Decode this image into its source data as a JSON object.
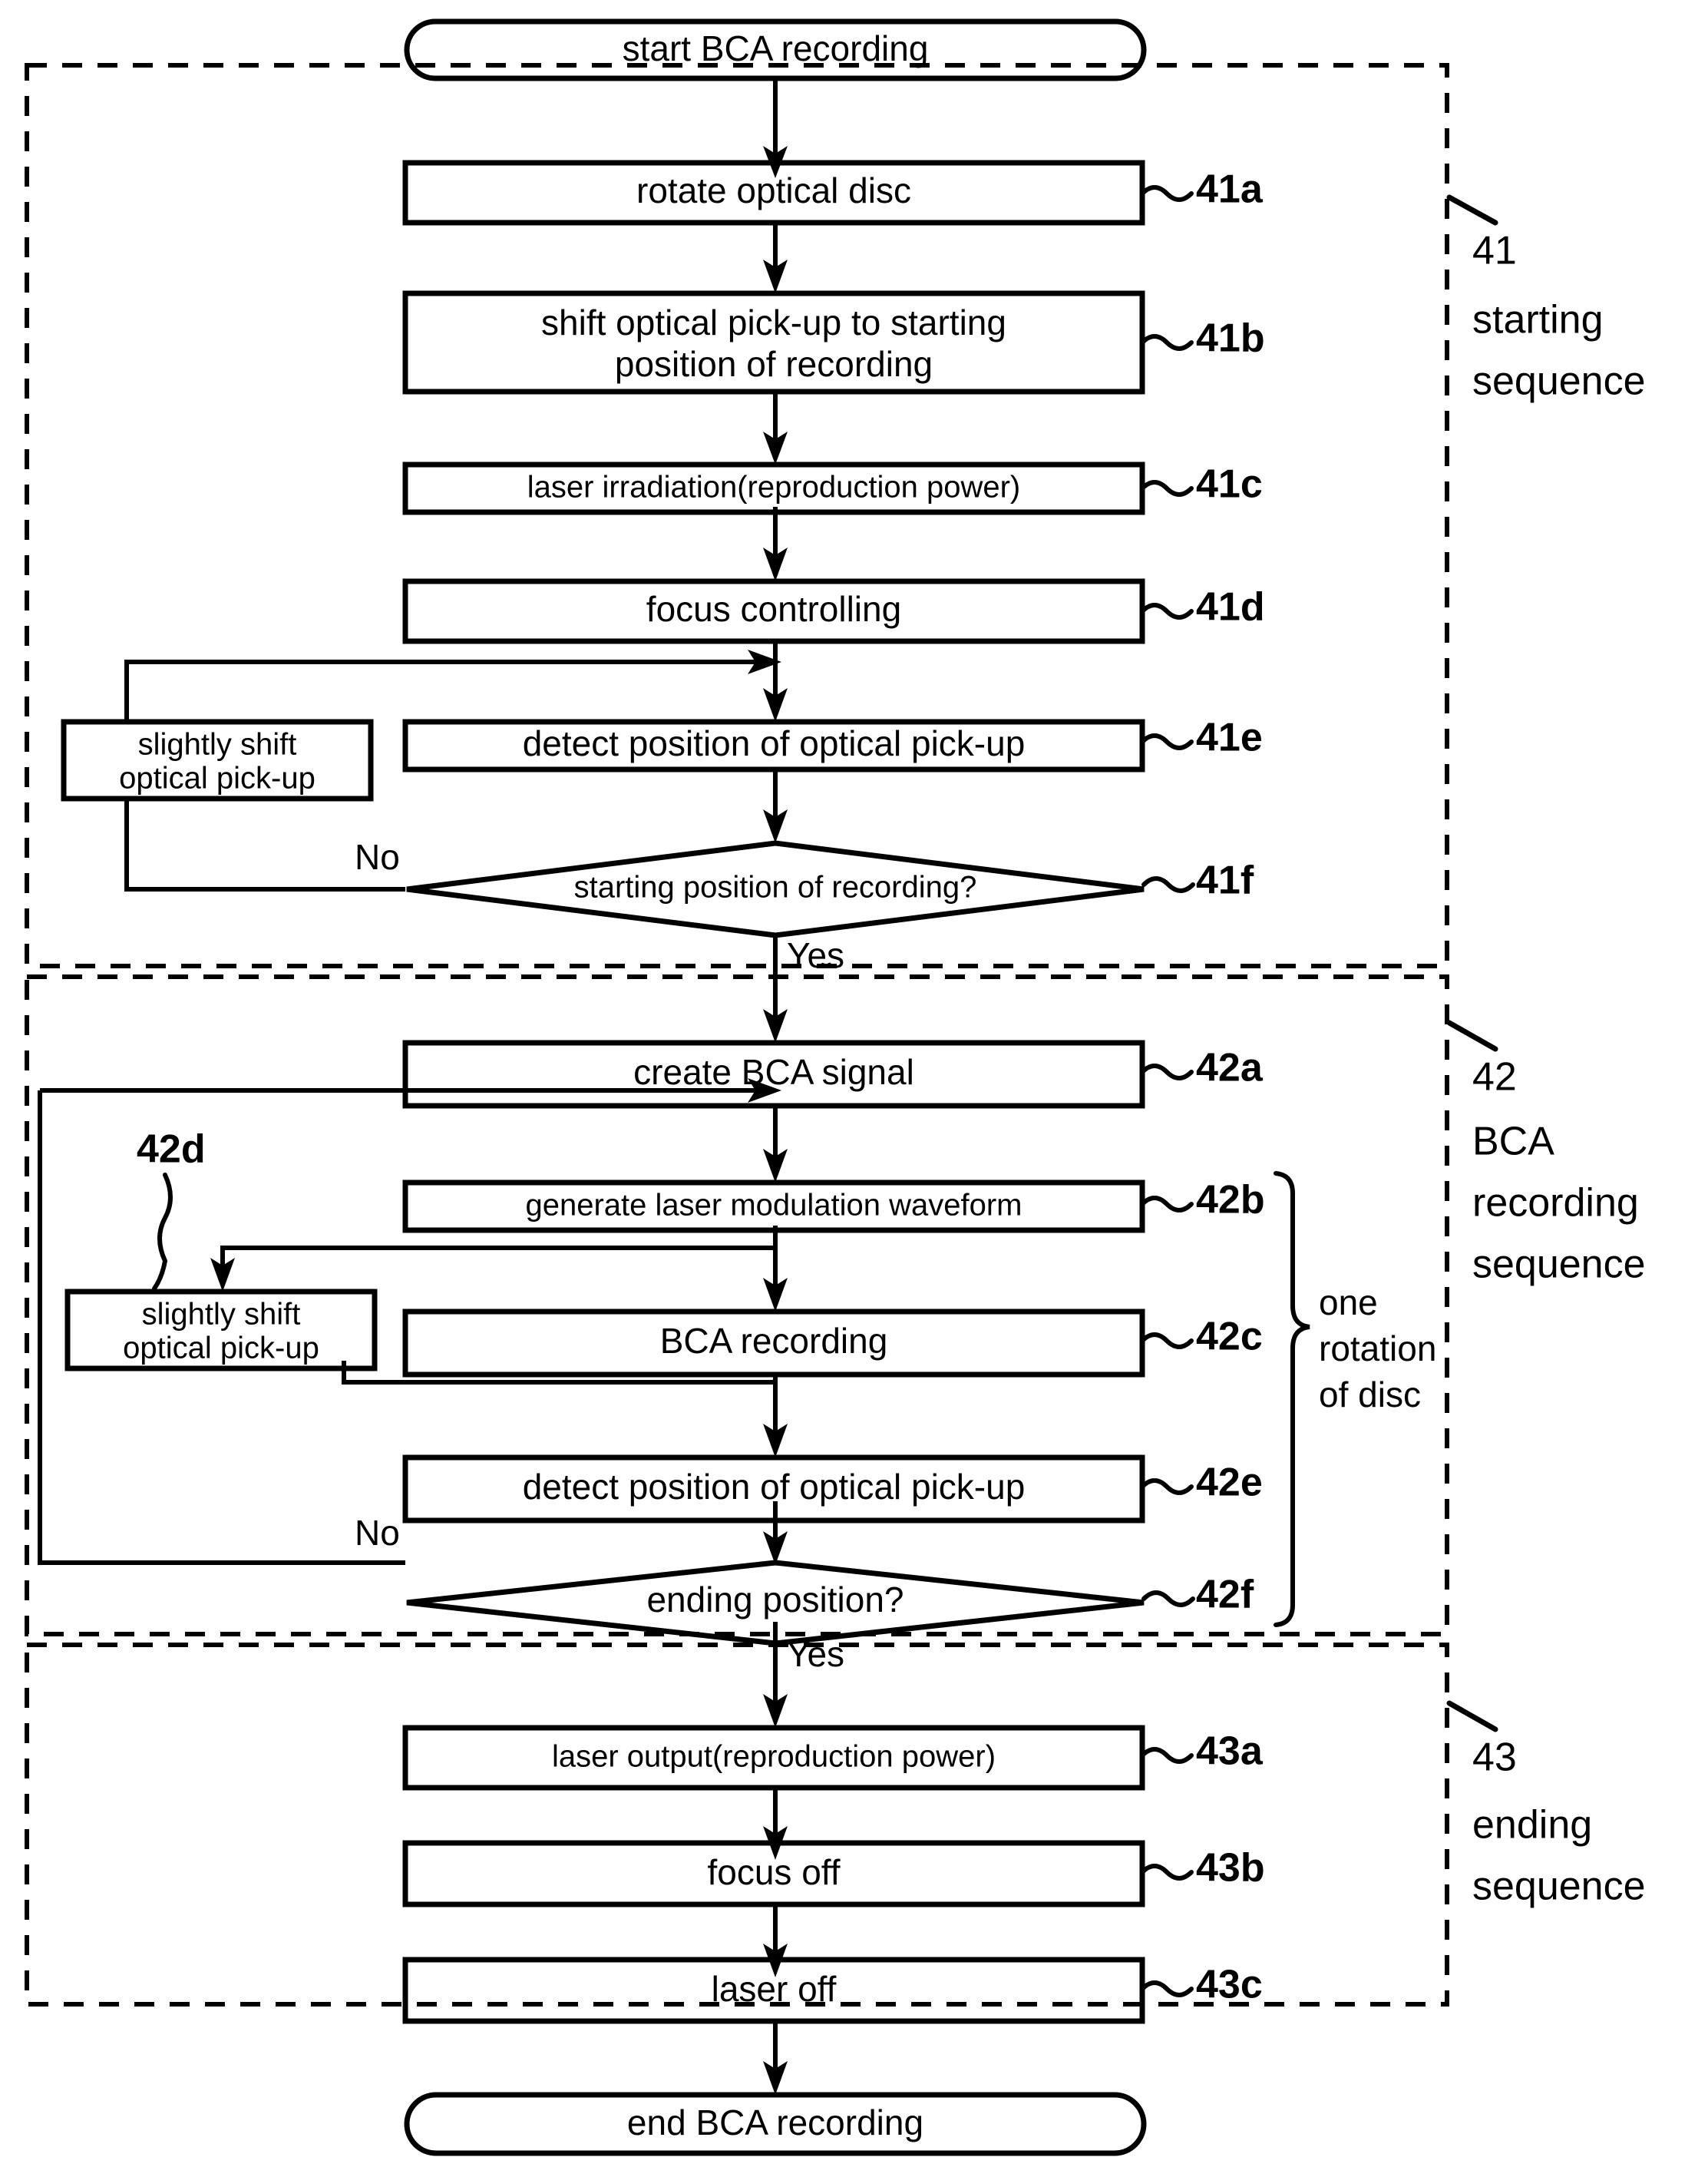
{
  "diagram": {
    "title": "BCA recording flowchart",
    "terminals": {
      "start": "start BCA recording",
      "end": "end BCA recording"
    },
    "sections": [
      {
        "ref": "41",
        "name_line1": "starting",
        "name_line2": "sequence"
      },
      {
        "ref": "42",
        "name_line1": "BCA",
        "name_line2": "recording",
        "name_line3": "sequence"
      },
      {
        "ref": "43",
        "name_line1": "ending",
        "name_line2": "sequence"
      }
    ],
    "steps": {
      "s41a": {
        "ref": "41a",
        "label": "rotate optical disc"
      },
      "s41b": {
        "ref": "41b",
        "label_line1": "shift optical pick-up to starting",
        "label_line2": "position of recording"
      },
      "s41c": {
        "ref": "41c",
        "label": "laser irradiation(reproduction power)"
      },
      "s41d": {
        "ref": "41d",
        "label": "focus controlling"
      },
      "s41e": {
        "ref": "41e",
        "label": "detect position of optical pick-up"
      },
      "s41f": {
        "ref": "41f",
        "label": "starting position of recording?"
      },
      "s41shift": {
        "label_line1": "slightly shift",
        "label_line2": "optical pick-up"
      },
      "s42a": {
        "ref": "42a",
        "label": "create BCA signal"
      },
      "s42b": {
        "ref": "42b",
        "label": "generate laser modulation waveform"
      },
      "s42c": {
        "ref": "42c",
        "label": "BCA recording"
      },
      "s42d": {
        "ref": "42d",
        "label_line1": "slightly shift",
        "label_line2": "optical pick-up"
      },
      "s42e": {
        "ref": "42e",
        "label": "detect position of optical pick-up"
      },
      "s42f": {
        "ref": "42f",
        "label": "ending position?"
      },
      "s43a": {
        "ref": "43a",
        "label": "laser output(reproduction power)"
      },
      "s43b": {
        "ref": "43b",
        "label": "focus off"
      },
      "s43c": {
        "ref": "43c",
        "label": "laser off"
      }
    },
    "branch_labels": {
      "no_41": "No",
      "yes_41": "Yes",
      "no_42": "No",
      "yes_42": "Yes"
    },
    "annotations": {
      "one_rotation_line1": "one",
      "one_rotation_line2": "rotation",
      "one_rotation_line3": "of disc"
    }
  }
}
